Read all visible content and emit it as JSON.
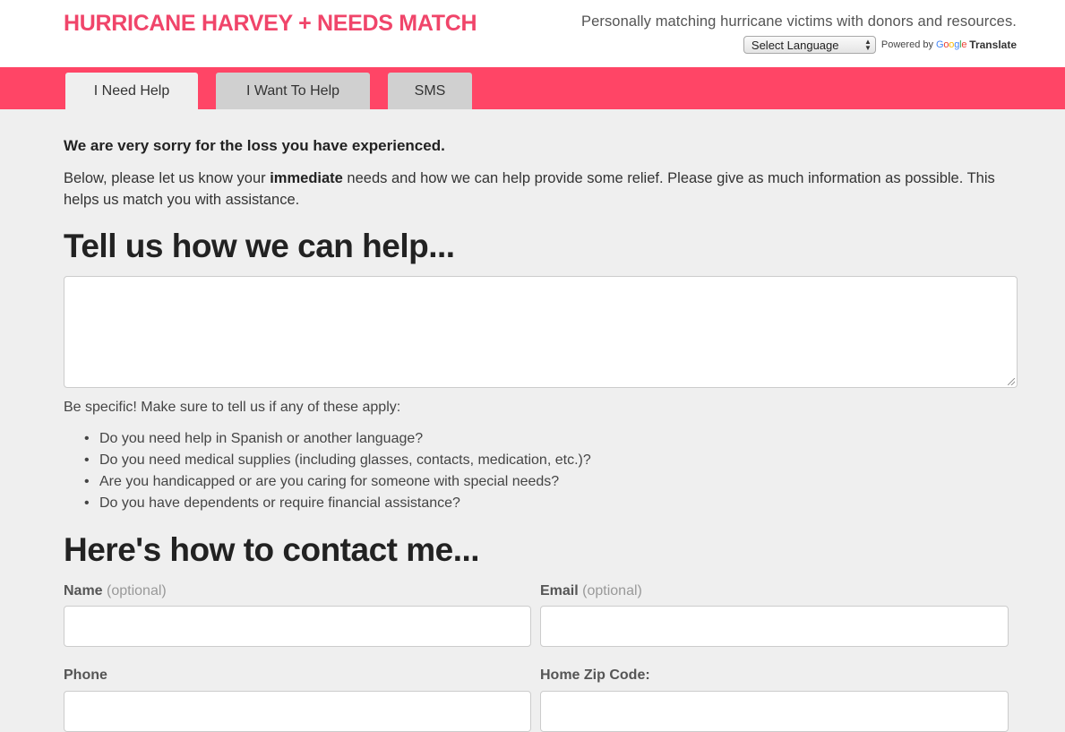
{
  "header": {
    "brand": "HURRICANE HARVEY + NEEDS MATCH",
    "tagline": "Personally matching hurricane victims with donors and resources.",
    "language_select": "Select Language",
    "powered_by": "Powered by",
    "google": "Google",
    "translate": "Translate"
  },
  "tabs": [
    {
      "label": "I Need Help",
      "active": true
    },
    {
      "label": "I Want To Help",
      "active": false
    },
    {
      "label": "SMS",
      "active": false
    }
  ],
  "main": {
    "sorry": "We are very sorry for the loss you have experienced.",
    "intro_before": "Below, please let us know your ",
    "intro_bold": "immediate",
    "intro_after": " needs and how we can help provide some relief. Please give as much information as possible. This helps us match you with assistance.",
    "help_heading": "Tell us how we can help...",
    "help_value": "",
    "specific": "Be specific! Make sure to tell us if any of these apply:",
    "bullets": [
      "Do you need help in Spanish or another language?",
      "Do you need medical supplies (including glasses, contacts, medication, etc.)?",
      "Are you handicapped or are you caring for someone with special needs?",
      "Do you have dependents or require financial assistance?"
    ],
    "contact_heading": "Here's how to contact me...",
    "fields": {
      "name_label": "Name",
      "name_optional": "(optional)",
      "email_label": "Email",
      "email_optional": "(optional)",
      "phone_label": "Phone",
      "zip_label": "Home Zip Code:"
    }
  },
  "colors": {
    "brand": "#f0456a",
    "tabbar": "#ff4566",
    "background": "#efefef"
  }
}
